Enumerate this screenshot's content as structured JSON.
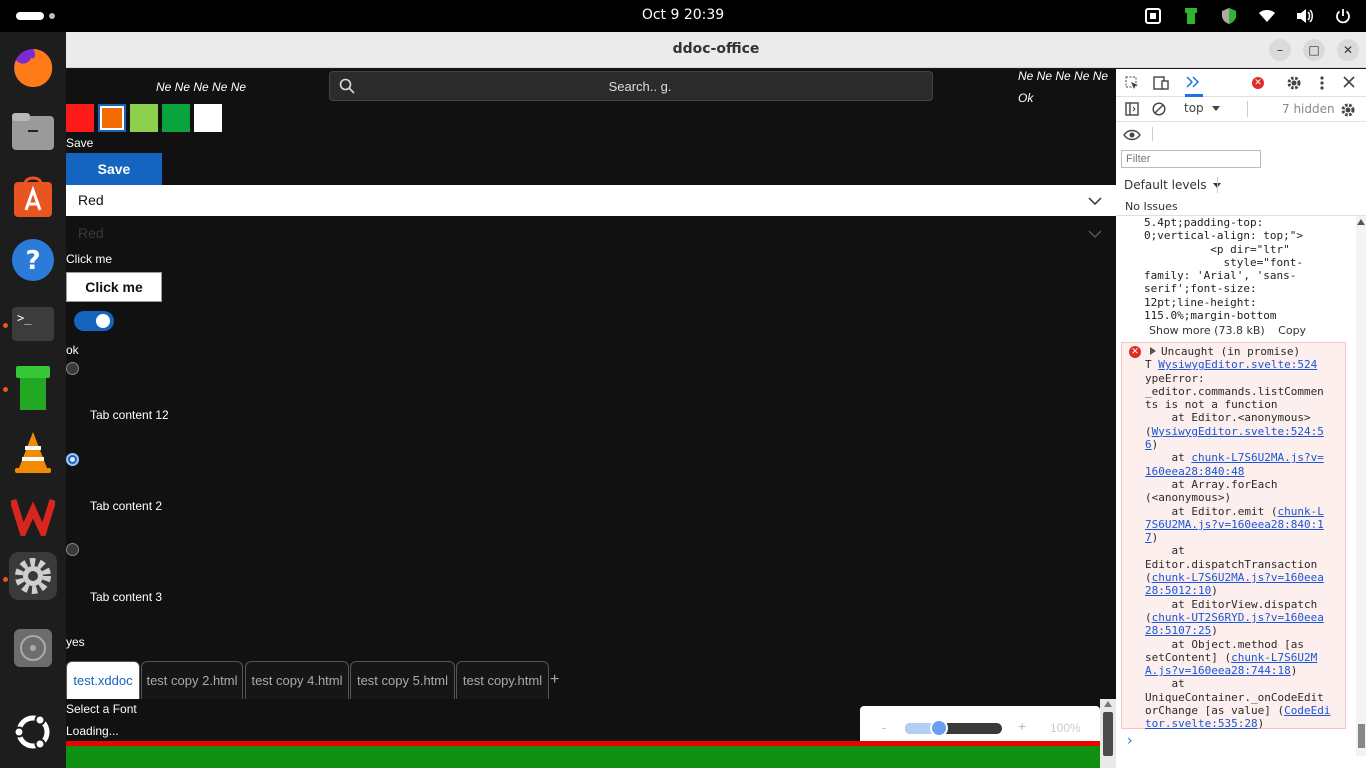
{
  "system_bar": {
    "clock": "Oct 9  20:39"
  },
  "window": {
    "title": "ddoc-office",
    "minimize": "–",
    "maximize": "□",
    "close": "✕"
  },
  "dock": {
    "items": [
      {
        "name": "firefox",
        "color": "#e66000"
      },
      {
        "name": "files",
        "color": "#8a8a8a"
      },
      {
        "name": "app-center",
        "color": "#e95420"
      },
      {
        "name": "help",
        "color": "#2b7bd8"
      },
      {
        "name": "terminal",
        "color": "#3c3c3c"
      },
      {
        "name": "green-pipe",
        "color": "#2fb52f"
      },
      {
        "name": "vlc",
        "color": "#f28b00"
      },
      {
        "name": "wps-office",
        "color": "#d7261e"
      },
      {
        "name": "settings",
        "color": "#8e8e8e"
      },
      {
        "name": "disk",
        "color": "#6d6d6d"
      },
      {
        "name": "ubuntu",
        "color": "#ffffff"
      }
    ]
  },
  "app": {
    "ne_left": "Ne Ne Ne Ne Ne",
    "ne_right": "Ne Ne Ne Ne Ne",
    "ok_right": "Ok",
    "search": {
      "placeholder": "Search.. g."
    },
    "swatches": [
      "#ff1a1a",
      "#f26a00",
      "#8ed04e",
      "#0aa33e",
      "#ffffff"
    ],
    "save_label": "Save",
    "save_button": "Save",
    "select_value": "Red",
    "select_ghost": "Red",
    "click_label": "Click me",
    "click_button": "Click me",
    "ok_label": "ok",
    "radios": [
      {
        "label": "Tab content 12",
        "checked": false
      },
      {
        "label": "Tab content 2",
        "checked": true
      },
      {
        "label": "Tab content 3",
        "checked": false
      }
    ],
    "yes_label": "yes",
    "tabs": [
      {
        "label": "test.xddoc",
        "active": true
      },
      {
        "label": "test copy 2.html",
        "active": false
      },
      {
        "label": "test copy 4.html",
        "active": false
      },
      {
        "label": "test copy 5.html",
        "active": false
      },
      {
        "label": "test copy.html",
        "active": false
      }
    ],
    "tab_add": "+",
    "font_label": "Select a Font",
    "loading": "Loading...",
    "zoom": {
      "minus": "-",
      "plus": "+",
      "percent": "100%",
      "level": 0.35
    }
  },
  "devtools": {
    "context": "top",
    "hidden": "7 hidden",
    "filter_placeholder": "Filter",
    "levels": "Default levels",
    "issues": "No Issues",
    "code": "5.4pt;padding-top:\n0;vertical-align: top;\">\n          <p dir=\"ltr\"\n            style=\"font-\nfamily: 'Arial', 'sans-\nserif';font-size:\n12pt;line-height:\n115.0%;margin-bottom",
    "show_more": "Show more (73.8 kB)",
    "copy": "Copy",
    "error": {
      "head": "Uncaught (in promise)",
      "lines": [
        {
          "t": "T ",
          "l": "WysiwygEditor.svelte:524"
        },
        {
          "t": "ypeError:\n_editor.commands.listCommen\nts is not a function\n    at Editor.<anonymous>\n(",
          "l": "WysiwygEditor.svelte:524:5\n6"
        },
        {
          "t": ")\n    at ",
          "l": "chunk-L7S6U2MA.js?v=\n160eea28:840:48"
        },
        {
          "t": "\n    at Array.forEach\n(<anonymous>)\n    at Editor.emit (",
          "l": "chunk-L\n7S6U2MA.js?v=160eea28:840:1\n7"
        },
        {
          "t": ")\n    at\nEditor.dispatchTransaction\n(",
          "l": "chunk-L7S6U2MA.js?v=160eea\n28:5012:10"
        },
        {
          "t": ")\n    at EditorView.dispatch\n(",
          "l": "chunk-UT2S6RYD.js?v=160eea\n28:5107:25"
        },
        {
          "t": ")\n    at Object.method [as\nsetContent] (",
          "l": "chunk-L7S6U2M\nA.js?v=160eea28:744:18"
        },
        {
          "t": ")\n    at\nUniqueContainer._onCodeEdit\norChange [as value] (",
          "l": "CodeEdi\ntor.svelte:535:28"
        },
        {
          "t": ")",
          "l": ""
        }
      ]
    },
    "prompt": "›"
  }
}
